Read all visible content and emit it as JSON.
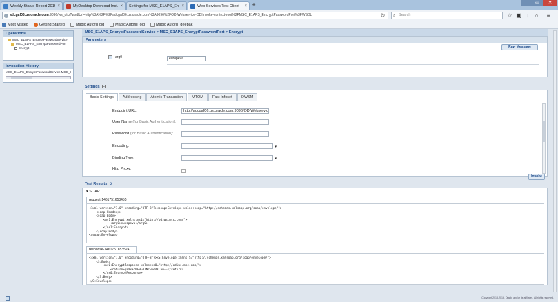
{
  "browser": {
    "tabs": [
      {
        "label": "Weekly Status Report 2016-...",
        "color": "#3b7dc4",
        "active": false
      },
      {
        "label": "MyDesktop Download Inst...",
        "color": "#c0392b",
        "active": false
      },
      {
        "label": "Settings for MSC_E1APS_Encryp...",
        "color": "#ffffff",
        "active": false
      },
      {
        "label": "Web Services Test Client",
        "color": "#2d6bb5",
        "active": true
      }
    ],
    "url_host": "adcgaf06.us.oracle.com",
    "url_rest": ":9096/ws_utc/?wsdlUrl=http%3A%2F%2Fadcgaf06.us.oracle.com%3A9096%2FODIWebservice-ODIInvoke-context-root%2FMSC_E1APS_EncryptPasswordPort%3FWSDL",
    "search_placeholder": "Search",
    "bookmarks": [
      {
        "label": "Most Visited",
        "color": "#4a7bb7"
      },
      {
        "label": "Getting Started",
        "color": "#e0661f"
      },
      {
        "label": "Magic Autofill old",
        "color": "#ffffff"
      },
      {
        "label": "Magic Autofill_old",
        "color": "#ffffff"
      },
      {
        "label": "Magic Autofill_deepak",
        "color": "#ffffff"
      }
    ]
  },
  "sidebar": {
    "operations_title": "Operations",
    "tree": {
      "service": "MSC_E1APS_EncryptPasswordService",
      "port": "MSC_E1APS_EncryptPasswordPort",
      "operation": "Encrypt"
    },
    "history_title": "Invocation History",
    "history_item": "MSC_E1APS_EncryptPasswordService.MSC_E1A"
  },
  "main": {
    "breadcrumb": "MSC_E1APS_EncryptPasswordService > MSC_E1APS_EncryptPasswordPort > Encrypt",
    "parameters_title": "Parameters",
    "raw_message_label": "Raw Message",
    "arg_label": "arg0",
    "arg_value": "europeva",
    "settings_title": "Settings",
    "settings_tabs": [
      "Basic Settings",
      "Addressing",
      "Atomic Transaction",
      "MTOM",
      "Fast Infoset",
      "OWSM"
    ],
    "fields": {
      "endpoint_label": "Endpoint URL:",
      "endpoint_value": "http://adcgaf06.us.oracle.com:9096/ODIWebservic",
      "username_label": "User Name",
      "username_hint": "(for Basic Authentication):",
      "password_label": "Password",
      "password_hint": "(for Basic Authentication):",
      "encoding_label": "Encoding:",
      "binding_label": "BindingType:",
      "proxy_label": "Http Proxy:"
    },
    "invoke_label": "Invoke",
    "results_title": "Test Results",
    "soap_label": "SOAP",
    "request_tab": "request-1461751653455",
    "request_xml": "<?xml version=\"1.0\" encoding=\"UTF-8\"?><soap:Envelope xmlns:soap=\"http://schemas.xmlsoap.org/soap/envelope/\">\n    <soap:Header/>\n    <soap:Body>\n        <ns1:Encrypt xmlns:ns1=\"http://odiws.msc.com/\">\n            <arg0>europeva</arg0>\n        </ns1:Encrypt>\n    </soap:Body>\n</soap:Envelope>",
    "response_tab": "response-1461751653524",
    "response_xml": "<?xml version=\"1.0\" encoding=\"UTF-8\"?><S:Envelope xmlns:S=\"http://schemas.xmlsoap.org/soap/envelope/\">\n    <S:Body>\n        <ns0:EncryptResponse xmlns:ns0=\"http://odiws.msc.com/\">\n            <return>gFXx+fNE9G0TNcwve4KCaw==</return>\n        </ns0:EncryptResponse>\n    </S:Body>\n</S:Envelope>"
  },
  "footer": {
    "copyright": "Copyright 2013-2016, Oracle and/or its affiliates. All rights reserved."
  }
}
